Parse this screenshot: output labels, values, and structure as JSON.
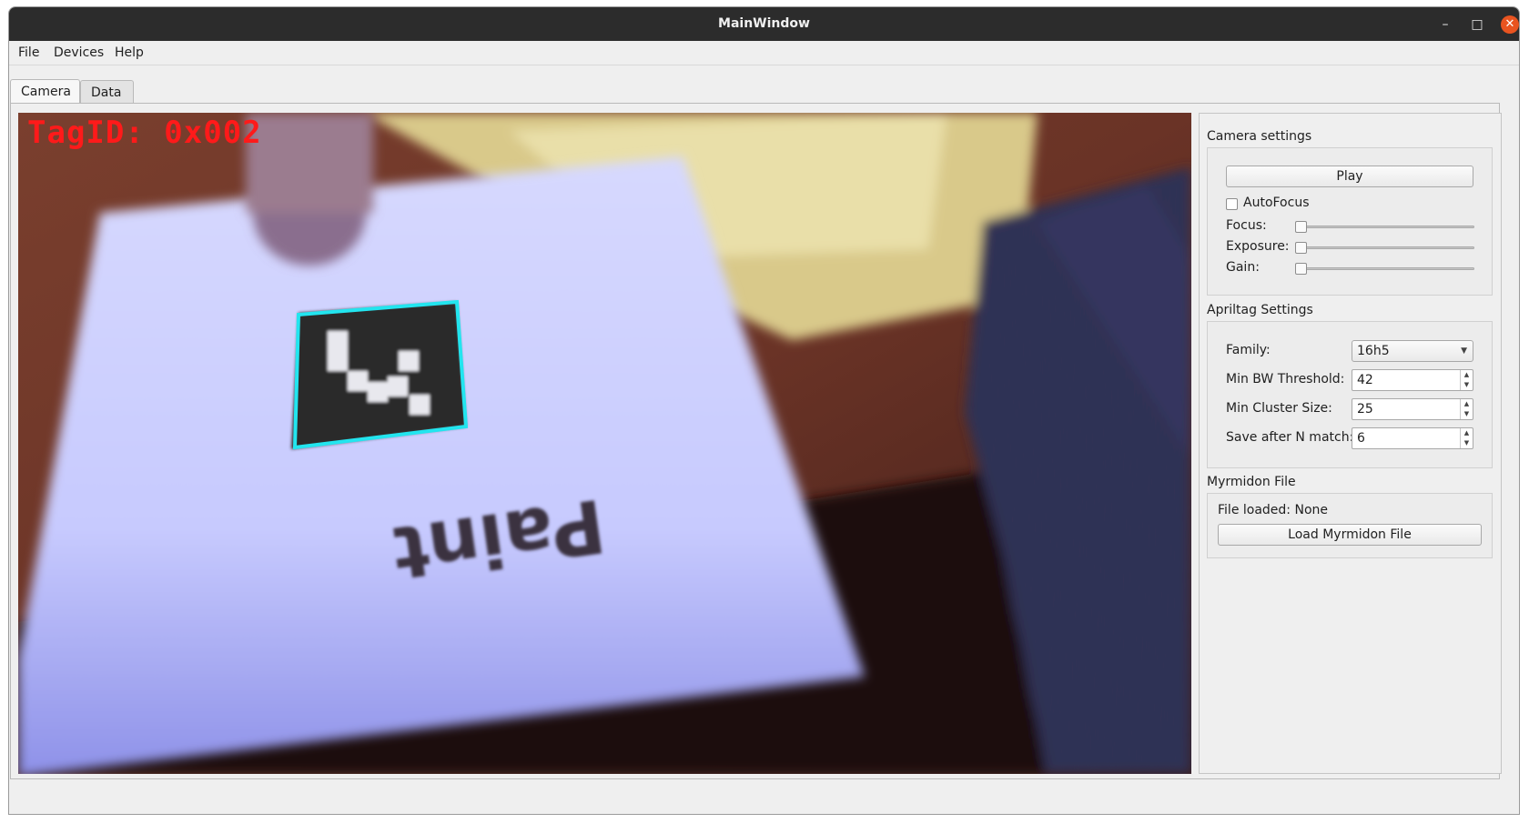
{
  "window": {
    "title": "MainWindow"
  },
  "titlebar_controls": {
    "minimize": "–",
    "maximize": "□",
    "close": "✕"
  },
  "menu": {
    "file": "File",
    "devices": "Devices",
    "help": "Help"
  },
  "tabs": [
    {
      "label": "Camera",
      "active": true
    },
    {
      "label": "Data",
      "active": false
    }
  ],
  "camera": {
    "overlay_text": "TagID: 0x002",
    "handwritten_text": "Paint"
  },
  "camera_settings": {
    "title": "Camera settings",
    "play_label": "Play",
    "autofocus_label": "AutoFocus",
    "autofocus_checked": false,
    "focus_label": "Focus:",
    "exposure_label": "Exposure:",
    "gain_label": "Gain:"
  },
  "apriltag_settings": {
    "title": "Apriltag Settings",
    "family_label": "Family:",
    "family_value": "16h5",
    "min_bw_label": "Min BW Threshold:",
    "min_bw_value": "42",
    "min_cluster_label": "Min Cluster Size:",
    "min_cluster_value": "25",
    "save_after_label": "Save after N match:",
    "save_after_value": "6"
  },
  "myrmidon": {
    "title": "Myrmidon File",
    "file_loaded": "File loaded: None",
    "load_label": "Load Myrmidon File"
  },
  "colors": {
    "overlay_red": "#ff1a1a",
    "tag_outline": "#22e5ef",
    "ubuntu_close": "#e95420"
  }
}
